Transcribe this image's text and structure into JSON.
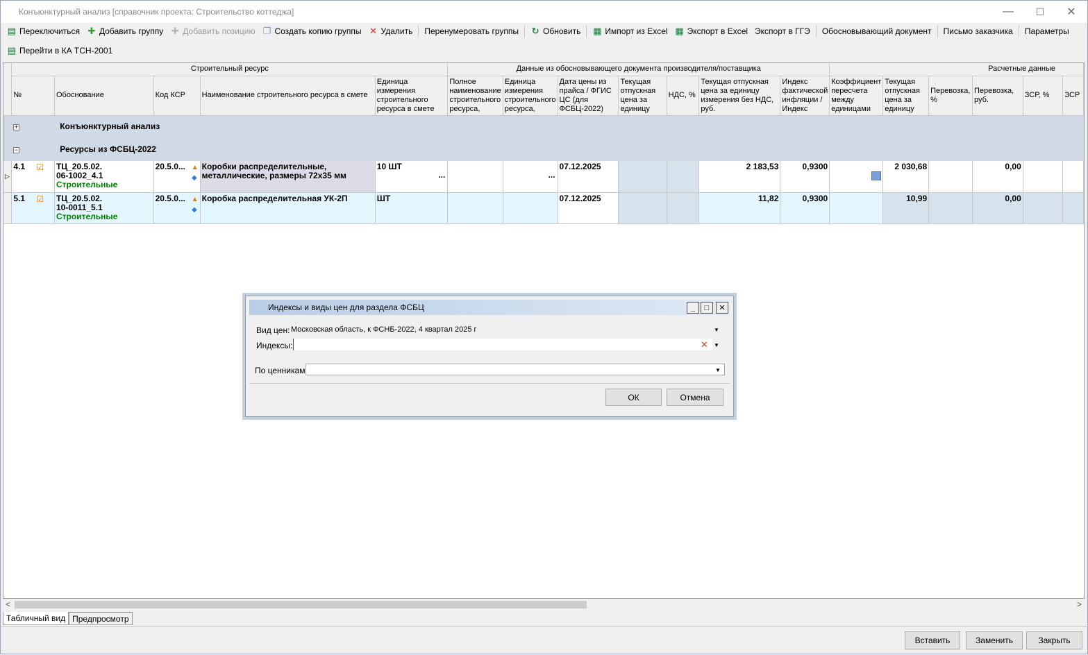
{
  "window": {
    "title": "Конъюнктурный анализ [справочник проекта: Строительство коттеджа]",
    "minimize": "—",
    "maximize": "☐",
    "close": "✕"
  },
  "toolbar1": {
    "switch": "Переключиться",
    "add_group": "Добавить группу",
    "add_position": "Добавить позицию",
    "copy_group": "Создать копию группы",
    "delete": "Удалить",
    "renumber": "Перенумеровать группы",
    "refresh": "Обновить",
    "import_excel": "Импорт из Excel",
    "export_excel": "Экспорт в Excel",
    "export_gge": "Экспорт в ГГЭ",
    "doc": "Обосновывающий документ",
    "letter": "Письмо заказчика",
    "params": "Параметры"
  },
  "toolbar2": {
    "goto_ka": "Перейти в КА ТСН-2001"
  },
  "grid": {
    "groups": {
      "resource": "Строительный ресурс",
      "supplier": "Данные из обосновывающего документа производителя/поставщика",
      "calc": "Расчетные данные"
    },
    "headers": {
      "num": "№",
      "basis": "Обоснование",
      "ksr": "Код КСР",
      "name": "Наименование строительного ресурса в смете",
      "unit": "Единица измерения строительного ресурса в смете",
      "full_name": "Полное наименование строительного ресурса,",
      "sup_unit": "Единица измерения строительного ресурса,",
      "price_date": "Дата цены из прайса / ФГИС ЦС (для ФСБЦ-2022)",
      "cur_price": "Текущая отпускная цена за единицу",
      "vat": "НДС, %",
      "cur_price_novat": "Текущая отпускная цена за единицу измерения без НДС, руб.",
      "index": "Индекс фактической инфляции / Индекс",
      "coef": "Коэффициент пересчета между единицами",
      "cur_price2": "Текущая отпускная цена за единицу",
      "transport_pct": "Перевозка, %",
      "transport_rub": "Перевозка, руб.",
      "zsr_pct": "ЗСР, %",
      "zsr": "ЗСР"
    },
    "group_rows": [
      {
        "sign": "+",
        "label": "Конъюнктурный анализ"
      },
      {
        "sign": "−",
        "label": "Ресурсы из ФСБЦ-2022"
      }
    ],
    "rows": [
      {
        "num": "4.1",
        "basis1": "ТЦ_20.5.02.",
        "basis2": "06-1002_4.1",
        "category": "Строительные",
        "ksr": "20.5.0...",
        "name1": "Коробки распределительные,",
        "name2": "металлические, размеры 72х35 мм",
        "unit": "10 ШТ",
        "price_date": "07.12.2025",
        "cur_price_novat": "2 183,53",
        "index": "0,9300",
        "cur_price2": "2 030,68",
        "transport_rub": "0,00"
      },
      {
        "num": "5.1",
        "basis1": "ТЦ_20.5.02.",
        "basis2": "10-0011_5.1",
        "category": "Строительные",
        "ksr": "20.5.0...",
        "name1": "Коробка распределительная УК-2П",
        "name2": "",
        "unit": "ШТ",
        "price_date": "07.12.2025",
        "cur_price_novat": "11,82",
        "index": "0,9300",
        "cur_price2": "10,99",
        "transport_rub": "0,00"
      }
    ],
    "dots": "..."
  },
  "tabs": {
    "table": "Табличный вид",
    "preview": "Предпросмотр"
  },
  "bottom": {
    "insert": "Вставить",
    "replace": "Заменить",
    "close": "Закрыть"
  },
  "dialog": {
    "title": "Индексы и виды цен для раздела ФСБЦ",
    "price_type_label": "Вид цен:",
    "price_type_value": "Московская область, к ФСНБ-2022, 4 квартал 2025 г",
    "indexes_label": "Индексы:",
    "indexes_value": "",
    "pricelist_label": "По ценникам",
    "pricelist_value": "",
    "ok": "ОК",
    "cancel": "Отмена"
  },
  "colors": {
    "group_row": "#d1d8e6",
    "row_highlight": "#e3f6fe",
    "category_text": "#008000"
  }
}
